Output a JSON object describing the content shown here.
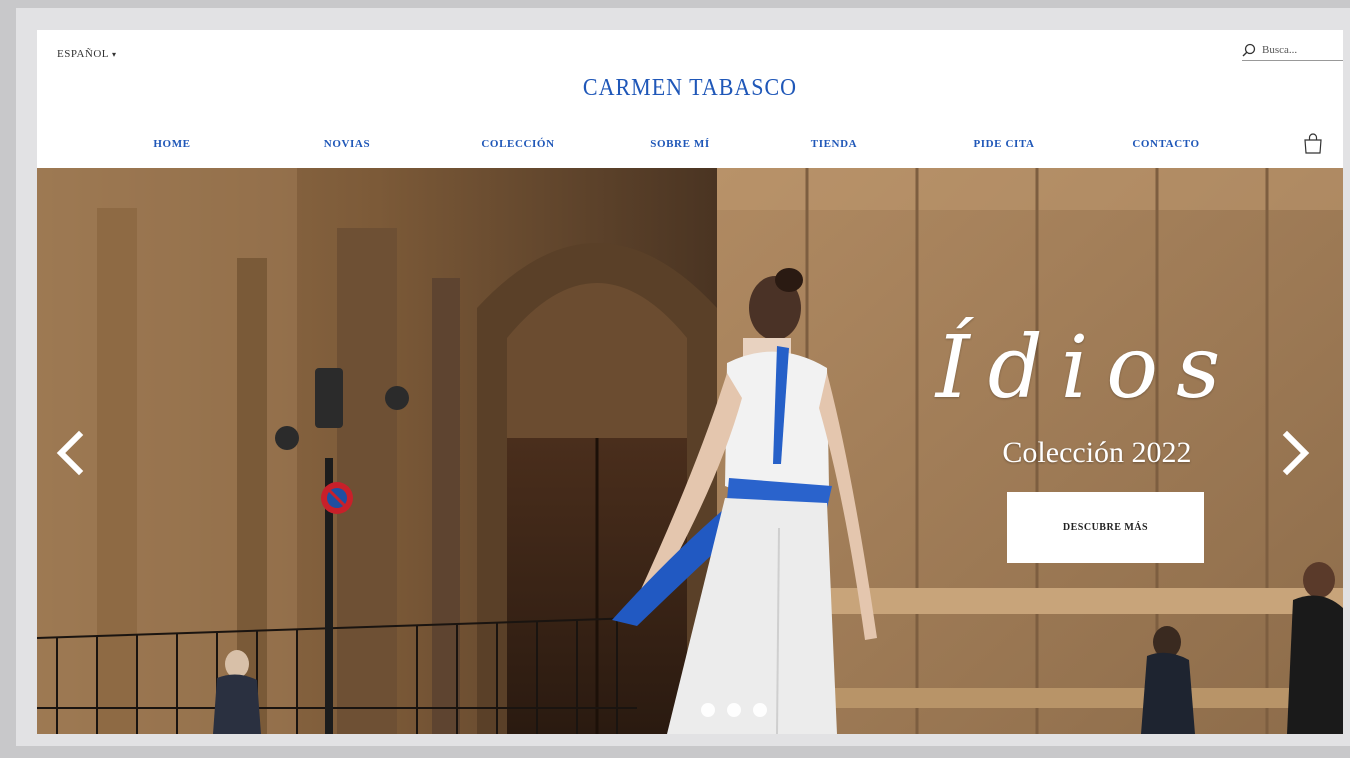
{
  "header": {
    "language": "ESPAÑOL",
    "search_placeholder": "Busca...",
    "brand": "CARMEN TABASCO",
    "nav": [
      "HOME",
      "NOVIAS",
      "COLECCIÓN",
      "SOBRE MÍ",
      "TIENDA",
      "PIDE CITA",
      "CONTACTO"
    ]
  },
  "hero": {
    "title": "Ídios",
    "subtitle": "Colección 2022",
    "cta_label": "DESCUBRE MÁS",
    "slides_total": 3,
    "slide_active": 2
  },
  "colors": {
    "brand_blue": "#1f57b8",
    "hero_text": "#ffffff",
    "cta_background": "#ffffff"
  },
  "icons": [
    "chevron-down-icon",
    "search-icon",
    "shopping-bag-icon",
    "chevron-left-icon",
    "chevron-right-icon"
  ]
}
